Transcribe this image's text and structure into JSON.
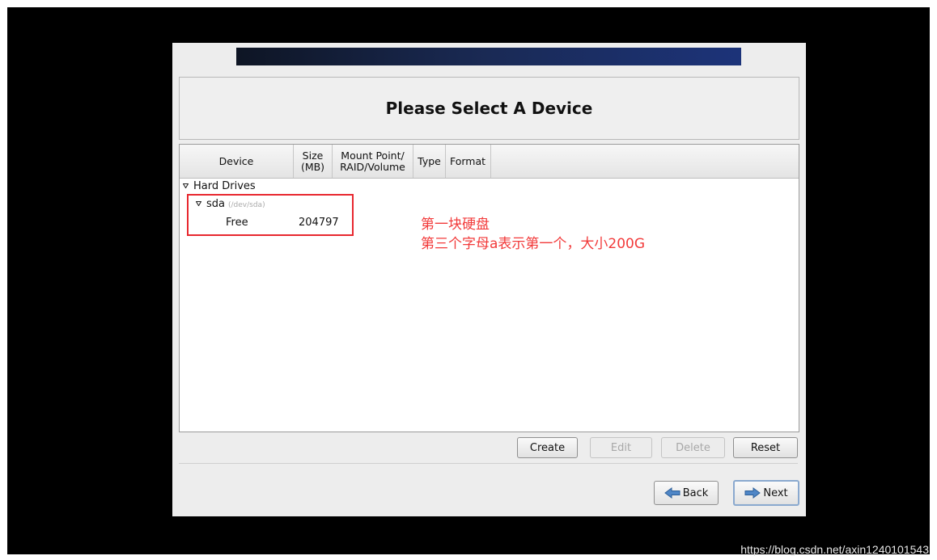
{
  "window": {
    "title": "Please Select A Device"
  },
  "table": {
    "columns": {
      "device": "Device",
      "size_line1": "Size",
      "size_line2": "(MB)",
      "mount_line1": "Mount Point/",
      "mount_line2": "RAID/Volume",
      "type": "Type",
      "format": "Format"
    },
    "group": "Hard Drives",
    "disk": {
      "name": "sda",
      "path": "(/dev/sda)"
    },
    "free_row": {
      "label": "Free",
      "size": "204797"
    }
  },
  "annotation": {
    "line1": "第一块硬盘",
    "line2": "第三个字母a表示第一个，大小200G"
  },
  "actions": {
    "create": "Create",
    "edit": "Edit",
    "delete": "Delete",
    "reset": "Reset"
  },
  "nav": {
    "back": "Back",
    "next": "Next"
  },
  "icons": {
    "back": "back-arrow-icon",
    "next": "next-arrow-icon",
    "expander": "expander-triangle-icon"
  },
  "colors": {
    "annotation": "#f23a3a",
    "banner": "#1a2a55"
  },
  "watermark": "https://blog.csdn.net/axin1240101543"
}
